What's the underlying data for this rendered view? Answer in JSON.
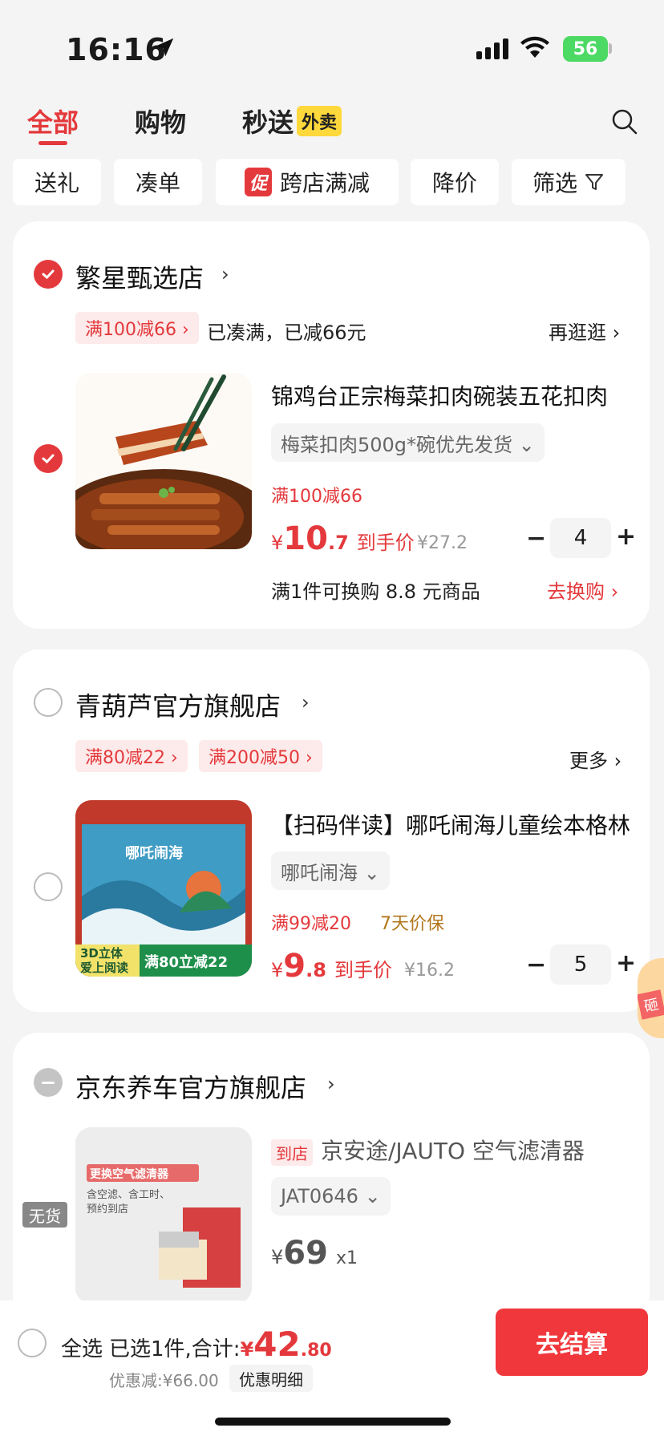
{
  "status_bar": {
    "time": "16:16",
    "battery": "56"
  },
  "tabs": [
    {
      "label": "全部"
    },
    {
      "label": "购物"
    },
    {
      "label": "秒送"
    }
  ],
  "tab_badge": "外卖",
  "filters": {
    "gift": "送礼",
    "combine": "凑单",
    "cross_badge": "促",
    "cross": "跨店满减",
    "price_drop": "降价",
    "filter": "筛选"
  },
  "shop1": {
    "name": "繁星甄选店",
    "promo_tag": "满100减66 ›",
    "promo_text": "已凑满，已减66元",
    "more": "再逛逛 ›",
    "item": {
      "title": "锦鸡台正宗梅菜扣肉碗装五花扣肉",
      "spec": "梅菜扣肉500g*碗优先发货 ⌄",
      "promo": "满100减66",
      "price_yen": "¥",
      "price_int": "10",
      "price_dec": ".7",
      "price_label": "到手价",
      "orig_price": "¥27.2",
      "qty": "4",
      "exchange": "满1件可换购 8.8 元商品",
      "go_exchange": "去换购 ›"
    }
  },
  "shop2": {
    "name": "青葫芦官方旗舰店",
    "promo_tag1": "满80减22 ›",
    "promo_tag2": "满200减50 ›",
    "more": "更多 ›",
    "item": {
      "title": "【扫码伴读】哪吒闹海儿童绘本格林",
      "spec": "哪吒闹海 ⌄",
      "promo": "满99减20",
      "guarantee": "7天价保",
      "price_yen": "¥",
      "price_int": "9",
      "price_dec": ".8",
      "price_label": "到手价",
      "orig_price": "¥16.2",
      "qty": "5",
      "thumb_text1": "3D立体",
      "thumb_text2": "爱上阅读",
      "thumb_text3": "满80立减22",
      "thumb_title": "哪吒闹海"
    }
  },
  "side_badge": "砸",
  "shop3": {
    "name": "京东养车官方旗舰店",
    "item": {
      "tag": "到店",
      "title": "京安途/JAUTO 空气滤清器",
      "spec": "JAT0646 ⌄",
      "price_yen": "¥",
      "price_int": "69",
      "qty_text": "x1",
      "stock": "无货",
      "thumb_head": "更换空气滤清器",
      "thumb_sub": "含空滤、含工时、预约到店"
    }
  },
  "bottom": {
    "select_all": "全选",
    "selected": "已选1件,合计:",
    "total_yen": "¥",
    "total_int": "42",
    "total_dec": ".80",
    "discount": "优惠减:¥66.00",
    "discount_detail": "优惠明细",
    "checkout": "去结算"
  },
  "colors": {
    "accent": "#e4393c",
    "badge_yellow": "#ffd83b"
  }
}
